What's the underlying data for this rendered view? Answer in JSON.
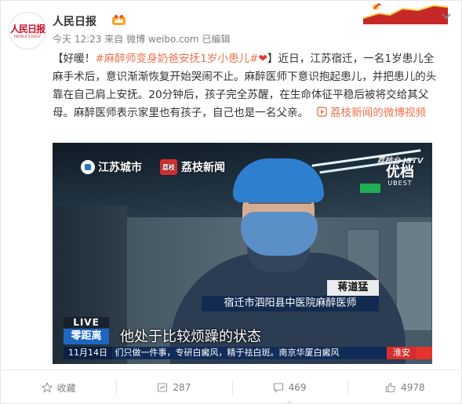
{
  "account": {
    "name": "人民日报",
    "logo_text": "人民日报",
    "logo_subtext": "PEOPLE'S DAILY",
    "verified_icon": "vip-crown-icon"
  },
  "post": {
    "time": "今天 12:23",
    "source_prefix": "来自",
    "source": "微博 weibo.com",
    "edited": "已编辑",
    "text_prefix": "【好暖！",
    "hashtag": "#麻醉师变身奶爸安抚1岁小患儿#",
    "heart": "❤",
    "text_body": "】近日，江苏宿迁，一名1岁患儿全麻手术后，意识渐渐恢复开始哭闹不止。麻醉医师下意识抱起患儿，并把患儿的头靠在自己肩上安抚。20分钟后，孩子完全苏醒，在生命体征平稳后被将交给其父母。麻醉医师表示家里也有孩子，自己也是一名父亲。",
    "video_link_icon": "video-link-icon",
    "video_link": "荔枝新闻的微博视频"
  },
  "video": {
    "brand_left": "江苏城市",
    "brand_mid": "荔枝新闻",
    "brand_mid_box": "荔枝",
    "ubest_top": "荔枝台 JSTV",
    "ubest_main": "优档",
    "ubest_en": "UBEST",
    "person_name": "蒋道猛",
    "person_title": "宿迁市泗阳县中医院麻醉医师",
    "live": "LIVE",
    "channel": "零距离",
    "subtitle": "他处于比较烦躁的状态",
    "ticker_date": "11月14日",
    "ticker_text": "们只做一件事，专研白癜风，精于祛白斑。南京华厦白癜风",
    "ticker_place": "淮安"
  },
  "footer": {
    "favorite": "收藏",
    "repost": "287",
    "comment": "469",
    "like": "4978"
  },
  "colors": {
    "link": "#eb7350",
    "text": "#333333",
    "meta": "#808080"
  }
}
